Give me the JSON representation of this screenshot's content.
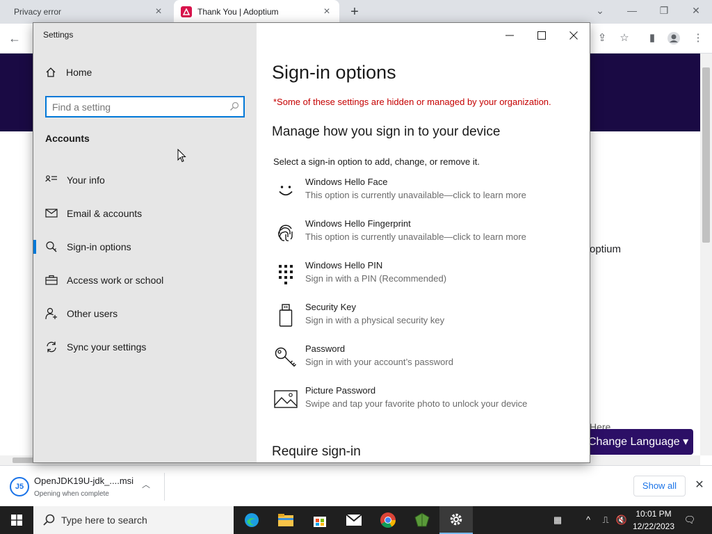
{
  "browser": {
    "tabs": [
      {
        "title": "Privacy error",
        "active": false
      },
      {
        "title": "Thank You | Adoptium",
        "active": true
      }
    ],
    "page": {
      "side_text": "optium",
      "side_text_partial": "Here",
      "change_language_label": "Change Language ▾"
    },
    "download": {
      "file_name": "OpenJDK19U-jdk_....msi",
      "status": "Opening when complete",
      "show_all_label": "Show all"
    }
  },
  "settings": {
    "window_title": "Settings",
    "nav": {
      "home_label": "Home",
      "search_placeholder": "Find a setting",
      "section_title": "Accounts",
      "items": [
        {
          "label": "Your info",
          "icon": "person-card-icon",
          "selected": false
        },
        {
          "label": "Email & accounts",
          "icon": "mail-icon",
          "selected": false
        },
        {
          "label": "Sign-in options",
          "icon": "key-search-icon",
          "selected": true
        },
        {
          "label": "Access work or school",
          "icon": "briefcase-icon",
          "selected": false
        },
        {
          "label": "Other users",
          "icon": "add-person-icon",
          "selected": false
        },
        {
          "label": "Sync your settings",
          "icon": "sync-icon",
          "selected": false
        }
      ]
    },
    "content": {
      "title": "Sign-in options",
      "org_warning": "*Some of these settings are hidden or managed by your organization.",
      "manage_heading": "Manage how you sign in to your device",
      "instruction": "Select a sign-in option to add, change, or remove it.",
      "options": [
        {
          "title": "Windows Hello Face",
          "description": "This option is currently unavailable—click to learn more",
          "icon": "face-icon"
        },
        {
          "title": "Windows Hello Fingerprint",
          "description": "This option is currently unavailable—click to learn more",
          "icon": "fingerprint-icon"
        },
        {
          "title": "Windows Hello PIN",
          "description": "Sign in with a PIN (Recommended)",
          "icon": "pin-keypad-icon"
        },
        {
          "title": "Security Key",
          "description": "Sign in with a physical security key",
          "icon": "usb-key-icon"
        },
        {
          "title": "Password",
          "description": "Sign in with your account’s password",
          "icon": "key-icon"
        },
        {
          "title": "Picture Password",
          "description": "Swipe and tap your favorite photo to unlock your device",
          "icon": "picture-icon"
        }
      ],
      "require_heading": "Require sign-in"
    }
  },
  "taskbar": {
    "search_placeholder": "Type here to search",
    "time": "10:01 PM",
    "date": "12/22/2023",
    "apps": [
      "edge-icon",
      "file-explorer-icon",
      "store-icon",
      "mail-icon",
      "chrome-icon",
      "minecraft-icon",
      "settings-gear-icon"
    ],
    "accent_color": "#0078d7"
  }
}
